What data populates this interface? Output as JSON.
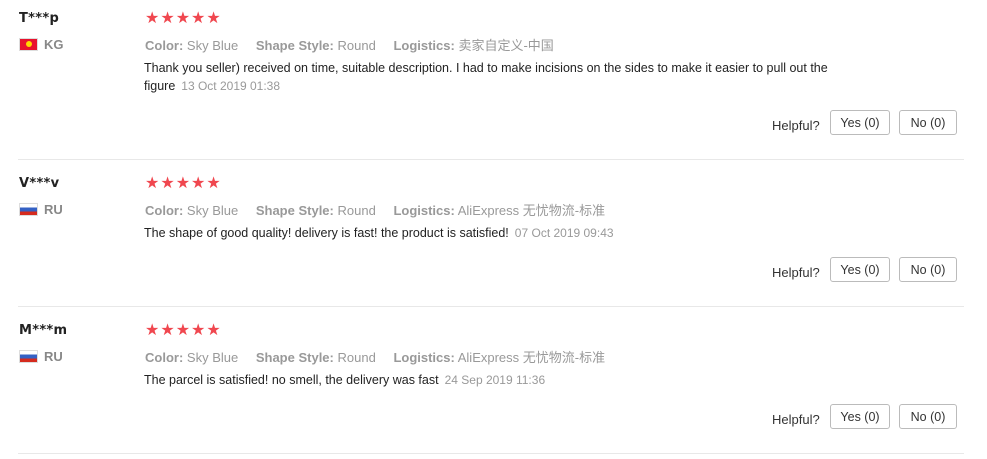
{
  "labels": {
    "color": "Color:",
    "shape_style": "Shape Style:",
    "logistics": "Logistics:",
    "helpful": "Helpful?"
  },
  "reviews": [
    {
      "user": "T***p",
      "country_code": "KG",
      "flag": "kyrgyzstan-flag-icon",
      "rating": 5,
      "stars": "★★★★★",
      "color": "Sky Blue",
      "shape_style": "Round",
      "logistics": "卖家自定义-中国",
      "text": "Thank you seller) received on time, suitable description. I had to make incisions on the sides to make it easier to pull out the figure",
      "date": "13 Oct 2019 01:38",
      "yes_label": "Yes (0)",
      "no_label": "No (0)"
    },
    {
      "user": "V***v",
      "country_code": "RU",
      "flag": "russia-flag-icon",
      "rating": 5,
      "stars": "★★★★★",
      "color": "Sky Blue",
      "shape_style": "Round",
      "logistics": "AliExpress 无忧物流-标准",
      "text": "The shape of good quality! delivery is fast! the product is satisfied!",
      "date": "07 Oct 2019 09:43",
      "yes_label": "Yes (0)",
      "no_label": "No (0)"
    },
    {
      "user": "M***m",
      "country_code": "RU",
      "flag": "russia-flag-icon",
      "rating": 5,
      "stars": "★★★★★",
      "color": "Sky Blue",
      "shape_style": "Round",
      "logistics": "AliExpress 无忧物流-标准",
      "text": "The parcel is satisfied! no smell, the delivery was fast",
      "date": "24 Sep 2019 11:36",
      "yes_label": "Yes (0)",
      "no_label": "No (0)"
    }
  ],
  "colors": {
    "star": "#f0474f",
    "muted": "#999999",
    "divider": "#e8e8e8"
  }
}
